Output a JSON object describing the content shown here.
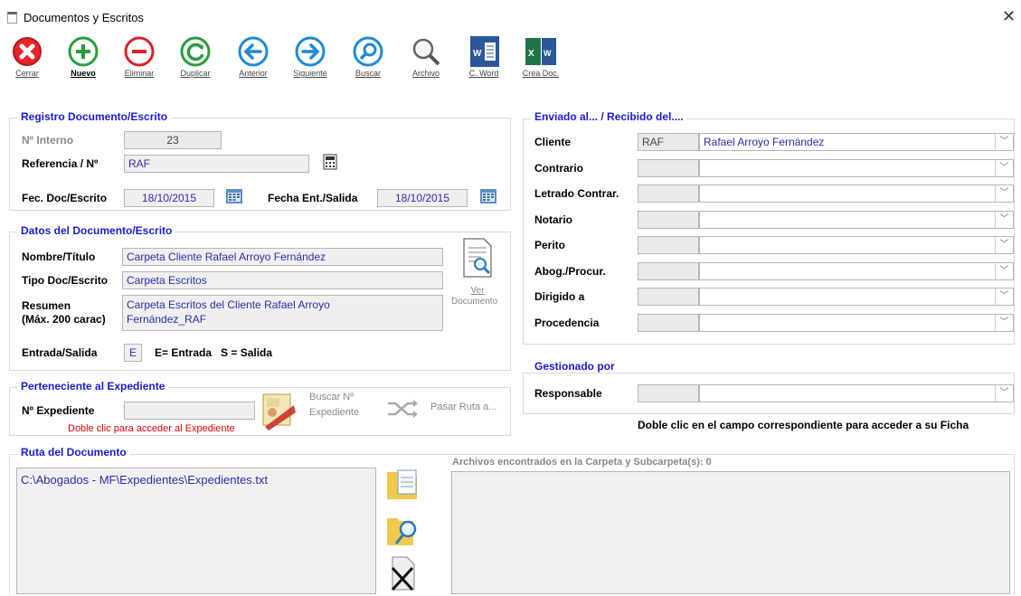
{
  "window": {
    "title": "Documentos y Escritos"
  },
  "toolbar": [
    {
      "label": "Cerrar",
      "icon": "close-circle-icon"
    },
    {
      "label": "Nuevo",
      "icon": "plus-circle-icon"
    },
    {
      "label": "Eliminar",
      "icon": "minus-circle-icon"
    },
    {
      "label": "Duplicar",
      "icon": "refresh-circle-icon"
    },
    {
      "label": "Anterior",
      "icon": "arrow-left-circle-icon"
    },
    {
      "label": "Siguiente",
      "icon": "arrow-right-circle-icon"
    },
    {
      "label": "Buscar",
      "icon": "search-circle-icon"
    },
    {
      "label": "Archivo",
      "icon": "magnifier-icon"
    },
    {
      "label": "C. Word",
      "icon": "word-icon"
    },
    {
      "label": "Crea Doc.",
      "icon": "excel-word-icon"
    }
  ],
  "registro": {
    "title": "Registro Documento/Escrito",
    "interno_label": "Nº Interno",
    "interno_value": "23",
    "referencia_label": "Referencia / Nº",
    "referencia_value": "RAF",
    "fec_doc_label": "Fec. Doc/Escrito",
    "fec_doc_value": "18/10/2015",
    "fec_ent_label": "Fecha Ent./Salida",
    "fec_ent_value": "18/10/2015"
  },
  "datos": {
    "title": "Datos del Documento/Escrito",
    "nombre_label": "Nombre/Título",
    "nombre_value": "Carpeta Cliente Rafael Arroyo Fernández",
    "tipo_label": "Tipo Doc/Escrito",
    "tipo_value": "Carpeta Escritos",
    "resumen_label": "Resumen",
    "resumen_sub": "(Máx. 200 carac)",
    "resumen_line1": "Carpeta Escritos del Cliente Rafael Arroyo",
    "resumen_line2": "Fernández_RAF",
    "ver_label1": "Ver",
    "ver_label2": "Documento",
    "es_label": "Entrada/Salida",
    "es_value": "E",
    "es_legend": "E= Entrada   S = Salida"
  },
  "expediente": {
    "title": "Perteneciente al Expediente",
    "num_label": "Nº Expediente",
    "num_value": "",
    "hint": "Doble clic para acceder al Expediente",
    "buscar1": "Buscar Nº",
    "buscar2": "Expediente",
    "pasar": "Pasar Ruta a..."
  },
  "enviado": {
    "title": "Enviado al... / Recibido del....",
    "rows": [
      {
        "label": "Cliente",
        "code": "RAF",
        "value": "Rafael Arroyo Fernández"
      },
      {
        "label": "Contrario",
        "code": "",
        "value": ""
      },
      {
        "label": "Letrado Contrar.",
        "code": "",
        "value": ""
      },
      {
        "label": "Notario",
        "code": "",
        "value": ""
      },
      {
        "label": "Perito",
        "code": "",
        "value": ""
      },
      {
        "label": "Abog./Procur.",
        "code": "",
        "value": ""
      },
      {
        "label": "Dirigido a",
        "code": "",
        "value": ""
      },
      {
        "label": "Procedencia",
        "code": "",
        "value": ""
      }
    ]
  },
  "gestionado": {
    "title": "Gestionado por",
    "responsable_label": "Responsable",
    "code": "",
    "value": "",
    "hint": "Doble clic en el campo correspondiente para acceder a su Ficha"
  },
  "ruta": {
    "title": "Ruta del Documento",
    "path": "C:\\Abogados - MF\\Expedientes\\Expedientes.txt",
    "archivos_label": "Archivos encontrados en la Carpeta y Subcarpeta(s):  0"
  }
}
